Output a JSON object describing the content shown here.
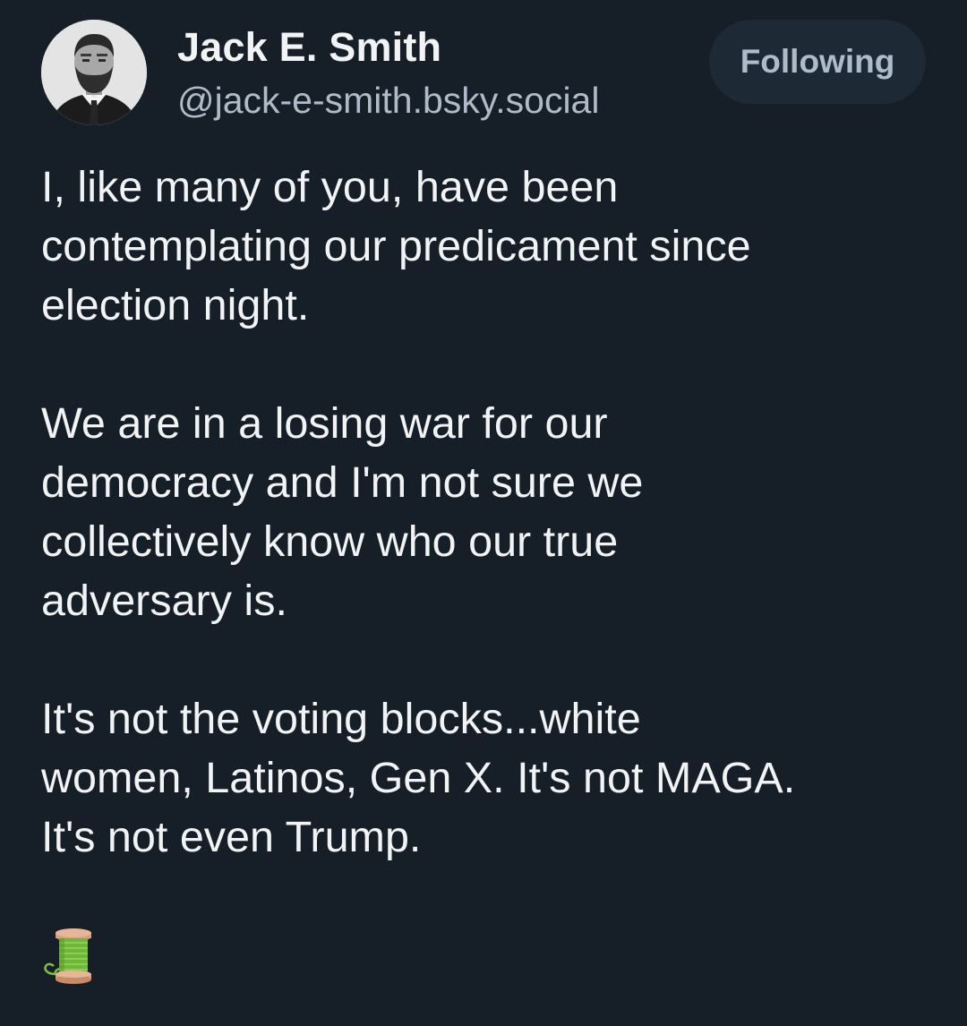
{
  "author": {
    "display_name": "Jack E. Smith",
    "handle": "@jack-e-smith.bsky.social",
    "avatar": "avatar-portrait"
  },
  "follow_button": {
    "label": "Following"
  },
  "post": {
    "paragraphs": [
      "I, like many of you, have been\ncontemplating our predicament since\nelection night.",
      "We are in a losing war for our\ndemocracy and I'm not sure we\ncollectively know who our true\nadversary is.",
      "It's not the voting blocks...white\nwomen, Latinos, Gen X. It's not MAGA.\nIt's not even Trump."
    ],
    "thread_icon": "spool-of-thread-icon"
  },
  "colors": {
    "background": "#161e27",
    "text_primary": "#f1f3f5",
    "text_secondary": "#aebbc9",
    "button_bg": "#1e2936"
  }
}
